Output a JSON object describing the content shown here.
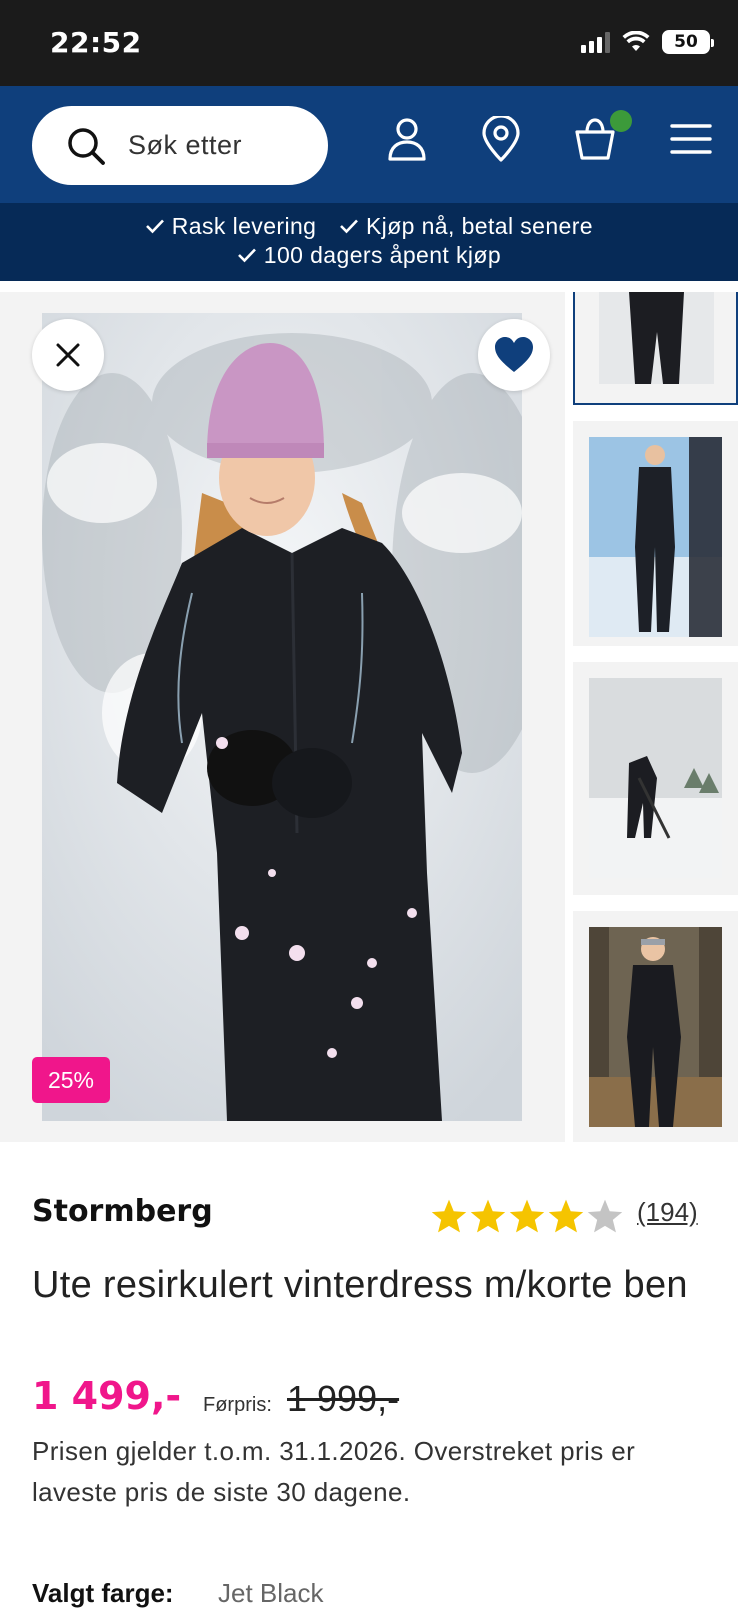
{
  "status_bar": {
    "time": "22:52",
    "battery": "50"
  },
  "header": {
    "search_placeholder": "Søk etter",
    "icons": [
      "search-icon",
      "user-icon",
      "location-pin-icon",
      "cart-icon",
      "menu-icon"
    ],
    "brand_color": "#0f3f7c",
    "cart_indicator_color": "#3c9a3a"
  },
  "usp": {
    "items": [
      "Rask levering",
      "Kjøp nå, betal senere",
      "100 dagers åpent kjøp"
    ]
  },
  "gallery": {
    "discount_badge": "25%",
    "icons": [
      "close-icon",
      "heart-icon"
    ]
  },
  "product": {
    "brand": "Stormberg",
    "rating": 4,
    "rating_max": 5,
    "reviews": "(194)",
    "title": "Ute resirkulert vinterdress m/korte ben",
    "price": "1 499,-",
    "before_label": "Førpris:",
    "before_price": "1 999,-",
    "price_note": "Prisen gjelder t.o.m. 31.1.2026. Overstreket pris er laveste pris de siste 30 dagene.",
    "color_label": "Valgt farge:",
    "color_value": "Jet Black",
    "accent_color": "#f0168b"
  }
}
